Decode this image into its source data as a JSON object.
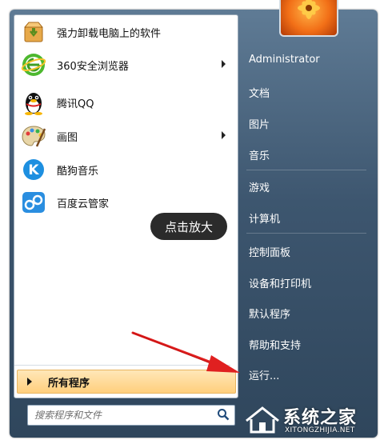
{
  "programs": [
    {
      "label": "强力卸载电脑上的软件",
      "icon": "uninstaller-box-icon",
      "has_submenu": false
    },
    {
      "label": "360安全浏览器",
      "icon": "360-browser-icon",
      "has_submenu": true
    },
    {
      "label": "腾讯QQ",
      "icon": "qq-penguin-icon",
      "has_submenu": false
    },
    {
      "label": "画图",
      "icon": "paint-palette-icon",
      "has_submenu": true
    },
    {
      "label": "酷狗音乐",
      "icon": "kugou-music-icon",
      "has_submenu": false
    },
    {
      "label": "百度云管家",
      "icon": "baidu-cloud-icon",
      "has_submenu": false
    }
  ],
  "all_programs_label": "所有程序",
  "search": {
    "placeholder": "搜索程序和文件",
    "icon": "search-magnifier-icon"
  },
  "right_pane": {
    "username": "Administrator",
    "items": [
      "文档",
      "图片",
      "音乐",
      "游戏",
      "计算机",
      "控制面板",
      "设备和打印机",
      "默认程序",
      "帮助和支持",
      "运行..."
    ]
  },
  "overlay": {
    "zoom_label": "点击放大"
  },
  "watermark": {
    "title": "系统之家",
    "url": "XITONGZHIJIA.NET"
  },
  "colors": {
    "accent_orange": "#ffcf7d",
    "menu_blue": "#3d566f",
    "arrow_red": "#e02020"
  }
}
